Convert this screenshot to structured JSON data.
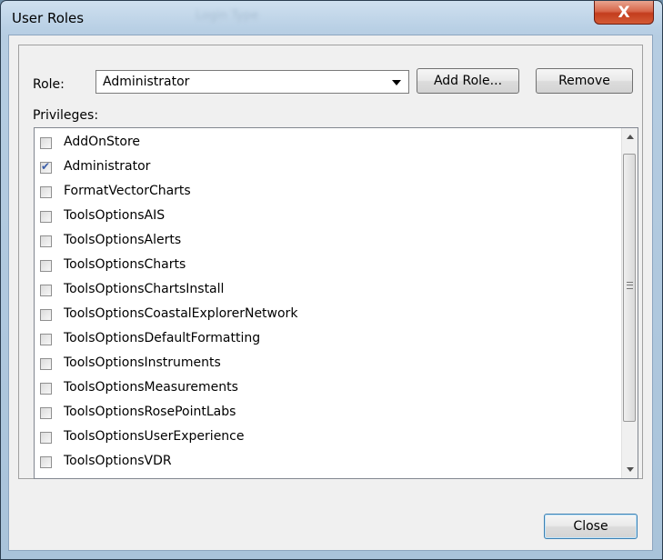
{
  "window": {
    "title": "User Roles",
    "ghost_title": "Login Type",
    "close_glyph": "X"
  },
  "role": {
    "label": "Role:",
    "selected": "Administrator",
    "add_label": "Add Role...",
    "remove_label": "Remove"
  },
  "privileges": {
    "label": "Privileges:",
    "items": [
      {
        "label": "AddOnStore",
        "checked": false
      },
      {
        "label": "Administrator",
        "checked": true
      },
      {
        "label": "FormatVectorCharts",
        "checked": false
      },
      {
        "label": "ToolsOptionsAIS",
        "checked": false
      },
      {
        "label": "ToolsOptionsAlerts",
        "checked": false
      },
      {
        "label": "ToolsOptionsCharts",
        "checked": false
      },
      {
        "label": "ToolsOptionsChartsInstall",
        "checked": false
      },
      {
        "label": "ToolsOptionsCoastalExplorerNetwork",
        "checked": false
      },
      {
        "label": "ToolsOptionsDefaultFormatting",
        "checked": false
      },
      {
        "label": "ToolsOptionsInstruments",
        "checked": false
      },
      {
        "label": "ToolsOptionsMeasurements",
        "checked": false
      },
      {
        "label": "ToolsOptionsRosePointLabs",
        "checked": false
      },
      {
        "label": "ToolsOptionsUserExperience",
        "checked": false
      },
      {
        "label": "ToolsOptionsVDR",
        "checked": false
      }
    ]
  },
  "footer": {
    "close_label": "Close"
  }
}
